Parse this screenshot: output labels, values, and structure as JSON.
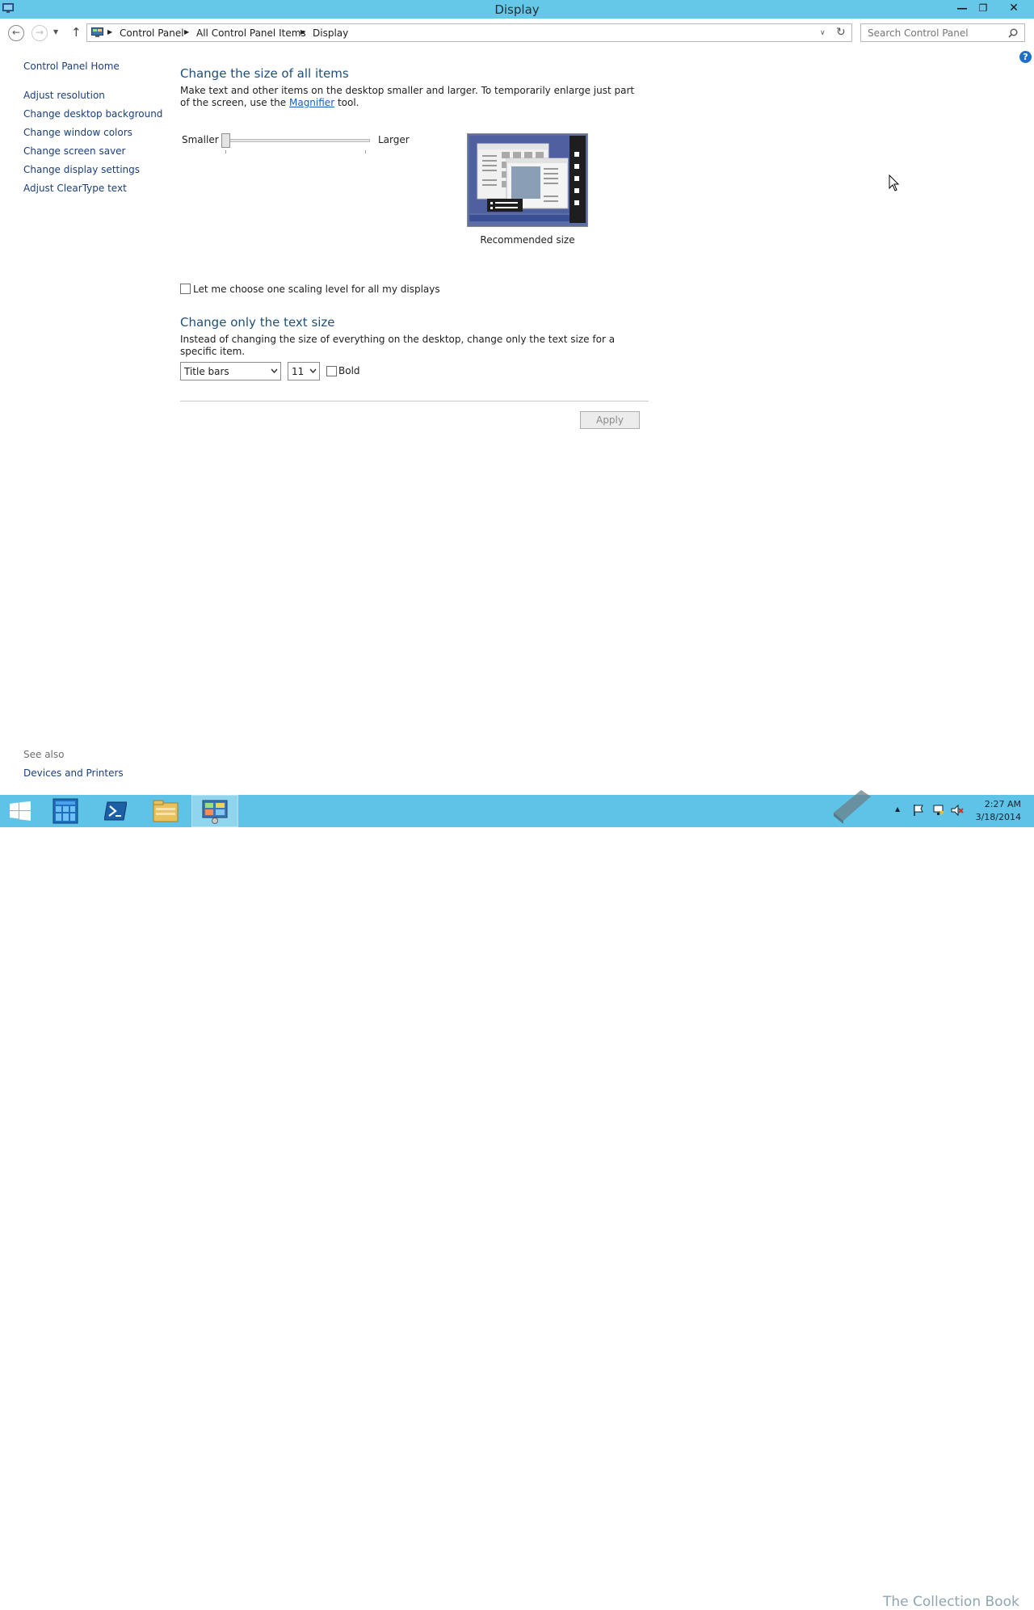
{
  "window": {
    "title": "Display",
    "minimize": "―",
    "restore": "❐",
    "close": "✕"
  },
  "address": {
    "crumbs": [
      "Control Panel",
      "All Control Panel Items",
      "Display"
    ],
    "search_placeholder": "Search Control Panel"
  },
  "sidebar": {
    "home": "Control Panel Home",
    "items": [
      "Adjust resolution",
      "Change desktop background",
      "Change window colors",
      "Change screen saver",
      "Change display settings",
      "Adjust ClearType text"
    ],
    "see_also_label": "See also",
    "see_also_items": [
      "Devices and Printers"
    ]
  },
  "size_section": {
    "heading": "Change the size of all items",
    "desc_before": "Make text and other items on the desktop smaller and larger. To temporarily enlarge just part of the screen, use the ",
    "desc_link": "Magnifier",
    "desc_after": " tool.",
    "smaller_label": "Smaller",
    "larger_label": "Larger",
    "slider_level": 0,
    "preview_caption": "Recommended size"
  },
  "scaling_checkbox": {
    "label": "Let me choose one scaling level for all my displays",
    "checked": false
  },
  "text_section": {
    "heading": "Change only the text size",
    "desc": "Instead of changing the size of everything on the desktop, change only the text size for a specific item.",
    "item_select": "Title bars",
    "size_select": "11",
    "bold_label": "Bold",
    "bold_checked": false
  },
  "apply_button": "Apply",
  "taskbar": {
    "time": "2:27 AM",
    "date": "3/18/2014",
    "watermark": "The Collection Book"
  },
  "colors": {
    "titlebar": "#66c8e8",
    "taskbar": "#5ec3e6",
    "link": "#1a3e78",
    "heading": "#1e4e79"
  }
}
